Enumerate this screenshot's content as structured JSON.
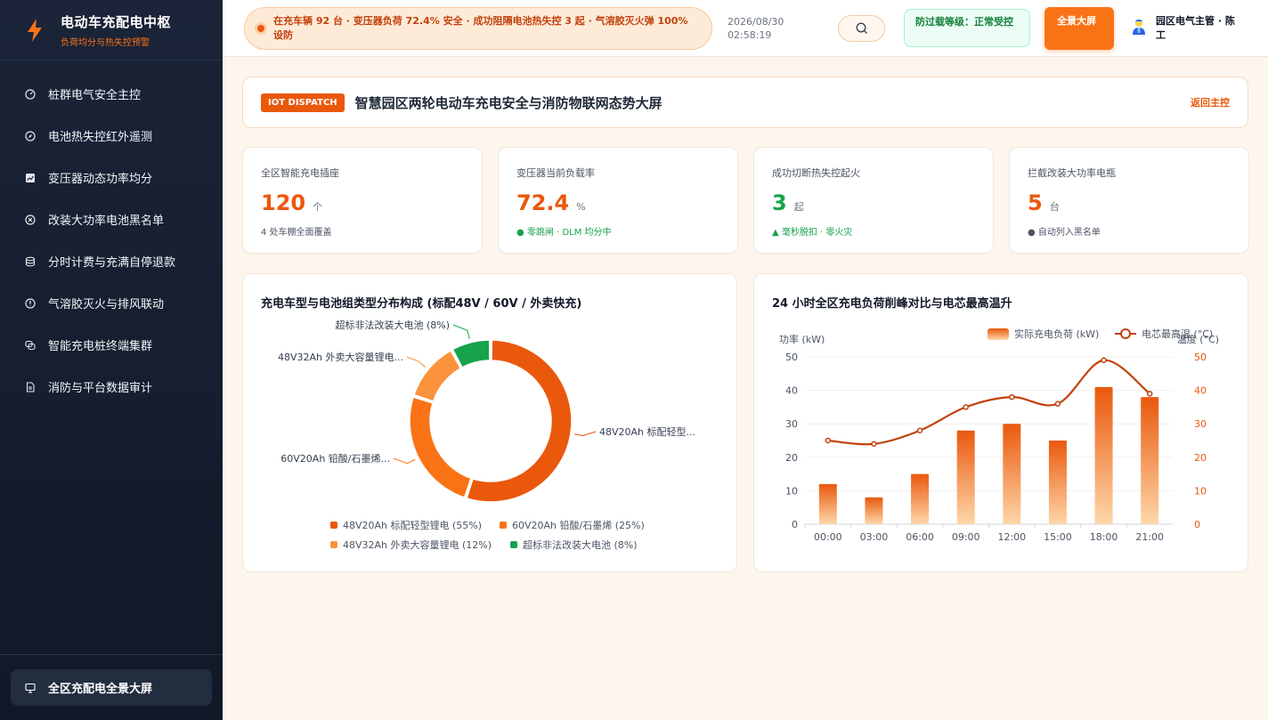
{
  "brand": {
    "title": "电动车充配电中枢",
    "subtitle": "负荷均分与热失控预警"
  },
  "nav": {
    "items": [
      {
        "label": "桩群电气安全主控",
        "icon": "gauge-icon"
      },
      {
        "label": "电池热失控红外遥测",
        "icon": "compass-icon"
      },
      {
        "label": "变压器动态功率均分",
        "icon": "chart-icon"
      },
      {
        "label": "改装大功率电池黑名单",
        "icon": "block-icon"
      },
      {
        "label": "分时计费与充满自停退款",
        "icon": "database-icon"
      },
      {
        "label": "气溶胶灭火与排风联动",
        "icon": "alert-circle-icon"
      },
      {
        "label": "智能充电桩终端集群",
        "icon": "layers-icon"
      },
      {
        "label": "消防与平台数据审计",
        "icon": "document-icon"
      }
    ],
    "bottom_item": {
      "label": "全区充配电全景大屏",
      "icon": "presentation-icon"
    }
  },
  "header": {
    "alert": "在充车辆 92 台 · 变压器负荷 72.4% 安全 · 成功阻隔电池热失控 3 起 · 气溶胶灭火弹 100% 设防",
    "date": "2026/08/30",
    "time": "02:58:19",
    "status": "防过载等级：正常受控",
    "fullscreen": "全景大屏",
    "user": "园区电气主管 · 陈工"
  },
  "titlebar": {
    "tag": "IOT DISPATCH",
    "title": "智慧园区两轮电动车充电安全与消防物联网态势大屏",
    "back": "返回主控"
  },
  "kpis": [
    {
      "label": "全区智能充电插座",
      "value": "120",
      "unit": "个",
      "note": "4 处车棚全面覆盖",
      "color": "#ea580c",
      "note_color": "#4b5563"
    },
    {
      "label": "变压器当前负载率",
      "value": "72.4",
      "unit": "%",
      "note": "● 零跳闸 · DLM 均分中",
      "color": "#ea580c",
      "note_color": "#16a34a"
    },
    {
      "label": "成功切断热失控起火",
      "value": "3",
      "unit": "起",
      "note": "▲ 毫秒脱扣 · 零火灾",
      "color": "#16a34a",
      "note_color": "#16a34a"
    },
    {
      "label": "拦截改装大功率电瓶",
      "value": "5",
      "unit": "台",
      "note": "● 自动列入黑名单",
      "color": "#ea580c",
      "note_color": "#4b5563"
    }
  ],
  "chart_data": [
    {
      "type": "pie",
      "title": "充电车型与电池组类型分布构成 (标配48V / 60V / 外卖快充)",
      "labels": [
        "48V20Ah 标配轻型锂电",
        "60V20Ah 铅酸/石墨烯",
        "48V32Ah 外卖大容量锂电",
        "超标非法改装大电池"
      ],
      "values": [
        55,
        25,
        12,
        8
      ],
      "colors": [
        "#ea580c",
        "#f97316",
        "#fb923c",
        "#16a34a"
      ],
      "callouts": [
        "48V20Ah 标配轻型...",
        "60V20Ah 铅酸/石墨烯...",
        "48V32Ah 外卖大容量锂电...",
        "超标非法改装大电池 (8%)"
      ],
      "legend": [
        "48V20Ah 标配轻型锂电 (55%)",
        "60V20Ah 铅酸/石墨烯 (25%)",
        "48V32Ah 外卖大容量锂电 (12%)",
        "超标非法改装大电池 (8%)"
      ],
      "donut": true
    },
    {
      "type": "bar",
      "title": "24 小时全区充电负荷削峰对比与电芯最高温升",
      "categories": [
        "00:00",
        "03:00",
        "06:00",
        "09:00",
        "12:00",
        "15:00",
        "18:00",
        "21:00"
      ],
      "series": [
        {
          "name": "实际充电负荷 (kW)",
          "type": "bar",
          "axis": "left",
          "values": [
            12,
            8,
            15,
            28,
            30,
            25,
            41,
            38
          ],
          "color": "#f97316"
        },
        {
          "name": "电芯最高温 (°C)",
          "type": "line",
          "axis": "right",
          "values": [
            25,
            24,
            28,
            35,
            38,
            36,
            49,
            39
          ],
          "color": "#c2410c"
        }
      ],
      "ylabel": "功率 (kW)",
      "y2label": "温度 (°C)",
      "ylim": [
        0,
        50
      ],
      "y2lim": [
        0,
        50
      ],
      "yticks": [
        0,
        10,
        20,
        30,
        40,
        50
      ],
      "legend_position": "top-right"
    }
  ]
}
